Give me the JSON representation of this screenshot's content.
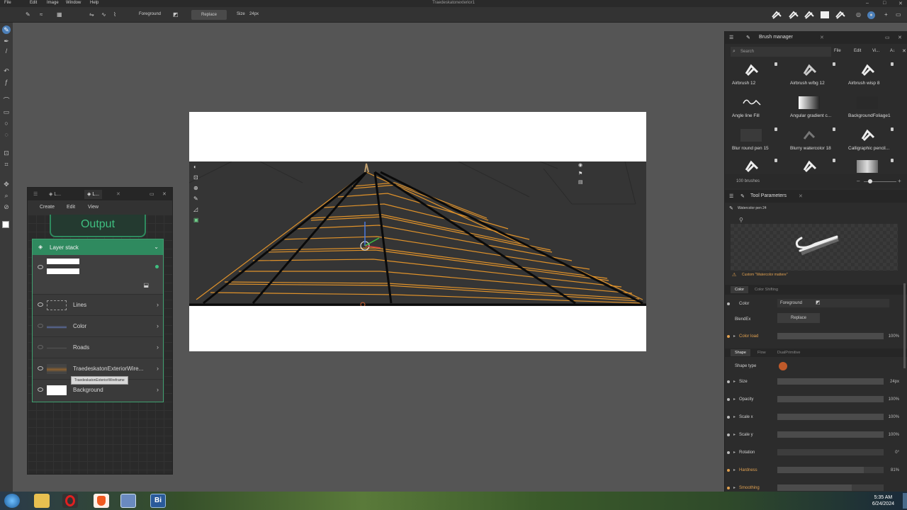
{
  "window": {
    "title": "Traedeskatonexterior1"
  },
  "menubar": {
    "items": [
      "File",
      "Edit",
      "Image",
      "Window",
      "Help"
    ]
  },
  "toolbar": {
    "blend_target": "Foreground",
    "replace_label": "Replace",
    "size_label": "Size",
    "size_value": "24px"
  },
  "layer_panel": {
    "tabs": [
      "L...",
      "L..."
    ],
    "menu": [
      "Create",
      "Edit",
      "View"
    ],
    "output_label": "Output",
    "stack_title": "Layer stack",
    "layers": [
      {
        "name": "Lines"
      },
      {
        "name": "Color"
      },
      {
        "name": "Roads"
      },
      {
        "name": "TraedeskatonExteriorWire..."
      },
      {
        "name": "Background"
      }
    ],
    "tooltip": "TraedeskatonExteriorWireframe"
  },
  "brush_manager": {
    "title": "Brush manager",
    "search_placeholder": "Search",
    "menu": [
      "File",
      "Edit",
      "Vi...",
      "A↓"
    ],
    "brushes": [
      "Airbrush 12",
      "Airbrush w/bg 12",
      "Airbrush wisp 8",
      "Angle line Fill",
      "Angular gradient c...",
      "BackgroundFoliage1",
      "Blur round pen 15",
      "Blurry watercolor 18",
      "Calligraphic pencil..."
    ],
    "count_label": "100 brushes"
  },
  "tool_parameters": {
    "title": "Tool Parameters",
    "brush_name": "Watercolor pen 24",
    "custom_label": "Custom \"Watercolor mattere\"",
    "tabs": [
      "Color",
      "Color Shifting"
    ],
    "color_label": "Color",
    "color_value": "Foreground",
    "blend_label": "BlendEx",
    "blend_value": "Replace",
    "color_load_label": "Color load",
    "color_load_value": "100%",
    "shape_tabs": [
      "Shape",
      "Flow",
      "DualPrimitive"
    ],
    "shape_type_label": "Shape type",
    "params": [
      {
        "label": "Size",
        "value": "24px",
        "fill": 1.0
      },
      {
        "label": "Opacity",
        "value": "100%",
        "fill": 1.0
      },
      {
        "label": "Scale x",
        "value": "100%",
        "fill": 1.0
      },
      {
        "label": "Scale y",
        "value": "100%",
        "fill": 1.0
      },
      {
        "label": "Rotation",
        "value": "0°",
        "fill": 0.0
      },
      {
        "label": "Hardness",
        "value": "81%",
        "fill": 0.81
      },
      {
        "label": "Smoothing",
        "value": "",
        "fill": 0.7
      }
    ]
  },
  "taskbar": {
    "time": "5:35 AM",
    "date": "6/24/2024",
    "bi_label": "Bi"
  },
  "colors": {
    "accent_green": "#2f8a5f",
    "wire_orange": "#e0922a",
    "canvas_white": "#ffffff"
  }
}
